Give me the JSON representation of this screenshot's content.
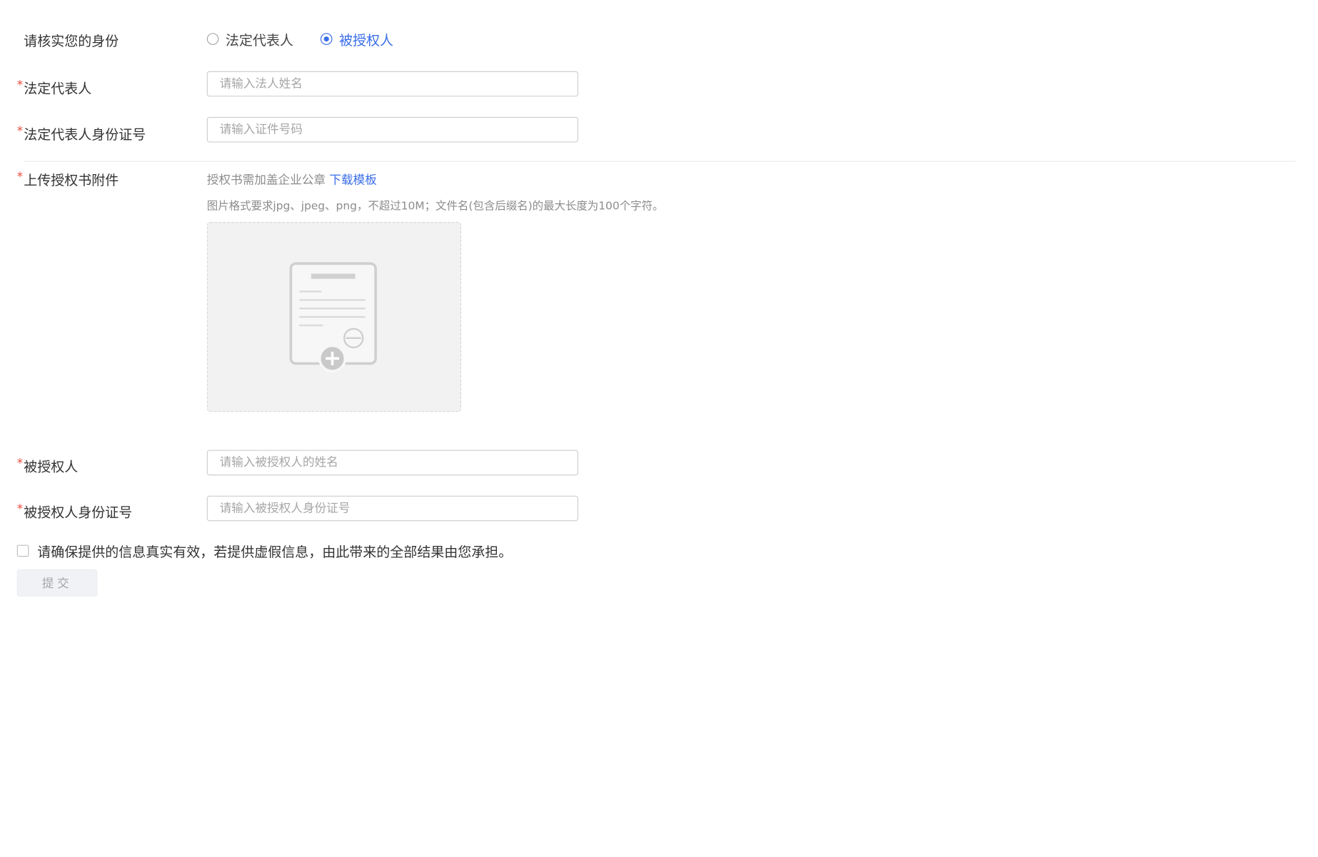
{
  "identity": {
    "label": "请核实您的身份",
    "options": [
      {
        "label": "法定代表人",
        "checked": false
      },
      {
        "label": "被授权人",
        "checked": true
      }
    ]
  },
  "legal_rep": {
    "label": "法定代表人",
    "placeholder": "请输入法人姓名"
  },
  "legal_rep_id": {
    "label": "法定代表人身份证号",
    "placeholder": "请输入证件号码"
  },
  "upload": {
    "label": "上传授权书附件",
    "hint": "授权书需加盖企业公章",
    "download_link": "下载模板",
    "format_hint": "图片格式要求jpg、jpeg、png，不超过10M；文件名(包含后缀名)的最大长度为100个字符。"
  },
  "grantee": {
    "label": "被授权人",
    "placeholder": "请输入被授权人的姓名"
  },
  "grantee_id": {
    "label": "被授权人身份证号",
    "placeholder": "请输入被授权人身份证号"
  },
  "agreement": {
    "text": "请确保提供的信息真实有效，若提供虚假信息，由此带来的全部结果由您承担。",
    "checked": false
  },
  "submit": {
    "label": "提交"
  },
  "colors": {
    "accent": "#3a6ee8",
    "required": "#e84b3c"
  }
}
